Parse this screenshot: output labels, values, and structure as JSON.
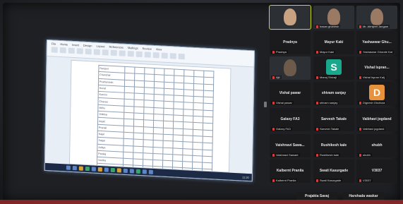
{
  "colors": {
    "active_border": "#c8d81f",
    "mic_muted": "#e03b3b",
    "avatar_s": "#1aa88d",
    "avatar_d": "#e8923c"
  },
  "shared_screen": {
    "tabs": [
      "File",
      "Home",
      "Insert",
      "Design",
      "Layout",
      "References",
      "Mailings",
      "Review",
      "View"
    ],
    "table_rows": [
      "Ranjeet",
      "Chanchal",
      "Prathamesh",
      "Kunal",
      "Kamini",
      "Chavan",
      "Mithu",
      "Shikhar",
      "Anjali",
      "Pranali",
      "Kajal",
      "Sagar",
      "Aditya",
      "Pankaj",
      "Sanika",
      "Rohit",
      "Tejas"
    ],
    "clock": "11:20"
  },
  "participants": [
    {
      "tile": "",
      "label": "",
      "type": "video",
      "active": true
    },
    {
      "tile": "",
      "label": "hasan ghanesh",
      "type": "video"
    },
    {
      "tile": "",
      "label": "Mr. Abhijeet Jangam",
      "type": "video"
    },
    {
      "tile": "Pradnya",
      "label": "Pradnya",
      "type": "name"
    },
    {
      "tile": "Mayur Kaki",
      "label": "Mayur Kaki",
      "type": "name"
    },
    {
      "tile": "Yashaswar Ghu...",
      "label": "Yashaswar Ghorale Kat",
      "type": "name"
    },
    {
      "tile": "",
      "label": "Ajit",
      "type": "video"
    },
    {
      "tile": "",
      "label": "Manoj Shivaji",
      "type": "avatar",
      "letter": "S",
      "color": "#1aa88d"
    },
    {
      "tile": "Vishal Ispran...",
      "label": "Vishal Ispran Kalj",
      "type": "name"
    },
    {
      "tile": "Vishal pawar",
      "label": "Vishal pawar",
      "type": "name"
    },
    {
      "tile": "shivam sanjay",
      "label": "shivam sanjay",
      "type": "name"
    },
    {
      "tile": "",
      "label": "Dignesh Ghuttura",
      "type": "avatar",
      "letter": "D",
      "color": "#e8923c"
    },
    {
      "tile": "Galaxy FA3",
      "label": "Galaxy FA3",
      "type": "name"
    },
    {
      "tile": "Sarvesh Takale",
      "label": "Sarvesh Takale",
      "type": "name"
    },
    {
      "tile": "Vaibhavi jogdand",
      "label": "Vaibhavi jogdand",
      "type": "name"
    },
    {
      "tile": "Vaishnavi Sawa...",
      "label": "Vaishnavi Sawant",
      "type": "name"
    },
    {
      "tile": "Rushikesh kale",
      "label": "Rushikesh kale",
      "type": "name"
    },
    {
      "tile": "shubh",
      "label": "shubh",
      "type": "name"
    },
    {
      "tile": "Kalbernt Pranila",
      "label": "Kalbernt Pranila",
      "type": "name"
    },
    {
      "tile": "Swati Kasurgade",
      "label": "Swati Kasurgade",
      "type": "name"
    },
    {
      "tile": "V3037",
      "label": "V3037",
      "type": "name"
    },
    {
      "tile": "Prajakta Savaj",
      "label": "",
      "type": "name"
    },
    {
      "tile": "Harshada waskar",
      "label": "",
      "type": "name"
    }
  ]
}
